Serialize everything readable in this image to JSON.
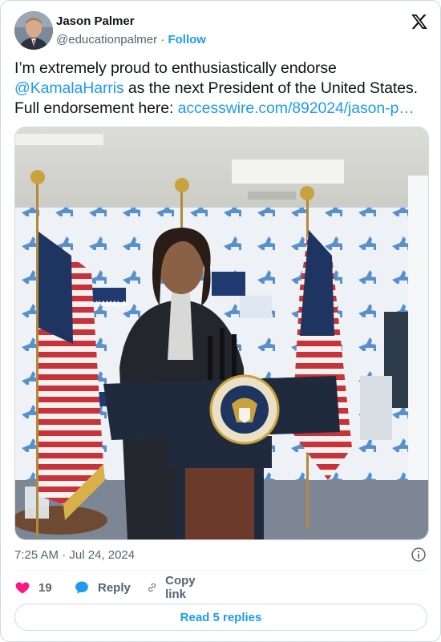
{
  "author": {
    "name": "Jason Palmer",
    "handle": "@educationpalmer",
    "separator": "·",
    "follow_label": "Follow"
  },
  "tweet": {
    "text_line1": "I’m extremely proud to enthusiastically endorse",
    "mention": "@KamalaHarris",
    "text_line2_rest": " as the next President of the United States.",
    "text_line3_prefix": "Full endorsement here: ",
    "link_text": "accesswire.com/892024/jason-p…"
  },
  "media": {
    "banner_text": "KAMALA",
    "partial_texts": [
      "KA",
      "ALA",
      "LA",
      "KA",
      "AMAL"
    ],
    "seal_text": "VICE PRESIDENT OF THE UNITED STATES"
  },
  "meta": {
    "timestamp": "7:25 AM · Jul 24, 2024"
  },
  "actions": {
    "like_count": "19",
    "reply_label": "Reply",
    "copy_link_label": "Copy link"
  },
  "read_replies_label": "Read 5 replies",
  "colors": {
    "accent": "#1d9bf0",
    "like": "#f91880",
    "muted": "#536471",
    "border": "#cfd9de"
  },
  "icons": [
    "x-logo-icon",
    "info-icon",
    "heart-icon",
    "reply-bubble-icon",
    "copy-link-icon"
  ]
}
